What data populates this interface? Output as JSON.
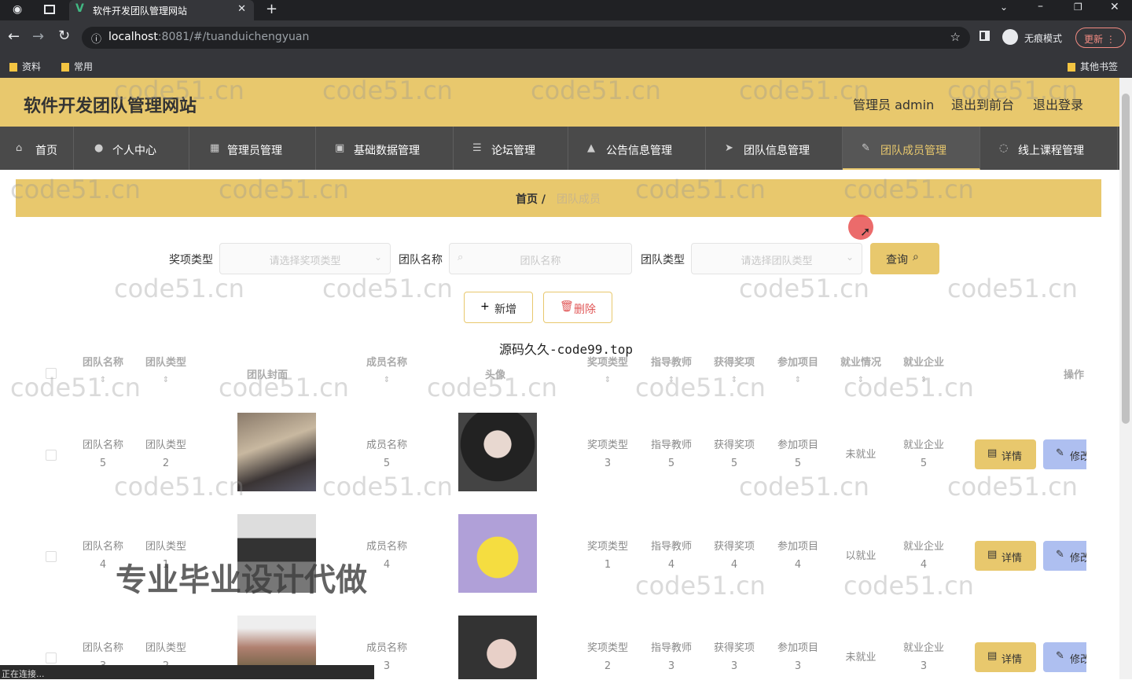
{
  "browser": {
    "tab_title": "软件开发团队管理网站",
    "url_host": "localhost",
    "url_rest": ":8081/#/tuanduichengyuan",
    "incognito_label": "无痕模式",
    "update_label": "更新",
    "bookmarks": [
      "资料",
      "常用"
    ],
    "other_bookmarks": "其他书签",
    "status_text": "正在连接..."
  },
  "header": {
    "site_title": "软件开发团队管理网站",
    "admin_label": "管理员 admin",
    "frontend_link": "退出到前台",
    "logout_link": "退出登录"
  },
  "nav": {
    "items": [
      {
        "label": "首页",
        "icon": "home-icon"
      },
      {
        "label": "个人中心",
        "icon": "user-icon"
      },
      {
        "label": "管理员管理",
        "icon": "admin-icon"
      },
      {
        "label": "基础数据管理",
        "icon": "grid-icon"
      },
      {
        "label": "论坛管理",
        "icon": "list-icon"
      },
      {
        "label": "公告信息管理",
        "icon": "notice-icon"
      },
      {
        "label": "团队信息管理",
        "icon": "send-icon"
      },
      {
        "label": "团队成员管理",
        "icon": "edit-icon"
      },
      {
        "label": "线上课程管理",
        "icon": "loading-icon"
      }
    ]
  },
  "breadcrumb": {
    "home": "首页",
    "sep": "/",
    "current": "团队成员"
  },
  "filters": {
    "award_label": "奖项类型",
    "award_placeholder": "请选择奖项类型",
    "team_name_label": "团队名称",
    "team_name_placeholder": "团队名称",
    "team_type_label": "团队类型",
    "team_type_placeholder": "请选择团队类型",
    "query_button": "查询"
  },
  "actions": {
    "add_button": "新增",
    "delete_button": "删除"
  },
  "overlay": {
    "center_text": "源码久久-code99.top",
    "promo_text": "专业毕业设计代做",
    "watermark": "code51.cn"
  },
  "table": {
    "headers": {
      "team_name": "团队名称",
      "team_type": "团队类型",
      "team_cover": "团队封面",
      "member_name": "成员名称",
      "avatar": "头像",
      "award_type": "奖项类型",
      "teacher": "指导教师",
      "award": "获得奖项",
      "project": "参加项目",
      "employment": "就业情况",
      "company": "就业企业",
      "operation": "操作"
    },
    "detail_label": "详情",
    "edit_label": "修改",
    "rows": [
      {
        "team_name": "团队名称",
        "team_name_n": "5",
        "team_type": "团队类型",
        "team_type_n": "2",
        "member_name": "成员名称",
        "member_name_n": "5",
        "award_type": "奖项类型",
        "award_type_n": "3",
        "teacher": "指导教师",
        "teacher_n": "5",
        "award": "获得奖项",
        "award_n": "5",
        "project": "参加项目",
        "project_n": "5",
        "employment": "未就业",
        "company": "就业企业",
        "company_n": "5"
      },
      {
        "team_name": "团队名称",
        "team_name_n": "4",
        "team_type": "团队类型",
        "team_type_n": "1",
        "member_name": "成员名称",
        "member_name_n": "4",
        "award_type": "奖项类型",
        "award_type_n": "1",
        "teacher": "指导教师",
        "teacher_n": "4",
        "award": "获得奖项",
        "award_n": "4",
        "project": "参加项目",
        "project_n": "4",
        "employment": "以就业",
        "company": "就业企业",
        "company_n": "4"
      },
      {
        "team_name": "团队名称",
        "team_name_n": "3",
        "team_type": "团队类型",
        "team_type_n": "2",
        "member_name": "成员名称",
        "member_name_n": "3",
        "award_type": "奖项类型",
        "award_type_n": "2",
        "teacher": "指导教师",
        "teacher_n": "3",
        "award": "获得奖项",
        "award_n": "3",
        "project": "参加项目",
        "project_n": "3",
        "employment": "未就业",
        "company": "就业企业",
        "company_n": "3"
      }
    ]
  }
}
